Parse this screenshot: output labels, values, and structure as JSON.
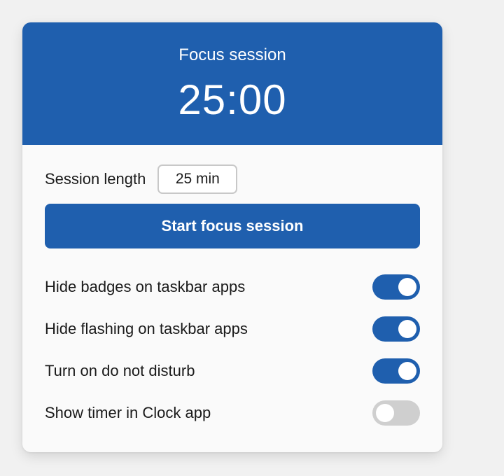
{
  "header": {
    "title": "Focus session",
    "timer": "25:00"
  },
  "session": {
    "length_label": "Session length",
    "length_value": "25 min"
  },
  "start_button": {
    "label": "Start focus session"
  },
  "options": [
    {
      "label": "Hide badges on taskbar apps",
      "enabled": true
    },
    {
      "label": "Hide flashing on taskbar apps",
      "enabled": true
    },
    {
      "label": "Turn on do not disturb",
      "enabled": true
    },
    {
      "label": "Show timer in Clock app",
      "enabled": false
    }
  ],
  "colors": {
    "accent": "#1f5fae",
    "toggle_off": "#cfcfcf",
    "card_bg": "#fafafa",
    "page_bg": "#f1f1f1"
  }
}
